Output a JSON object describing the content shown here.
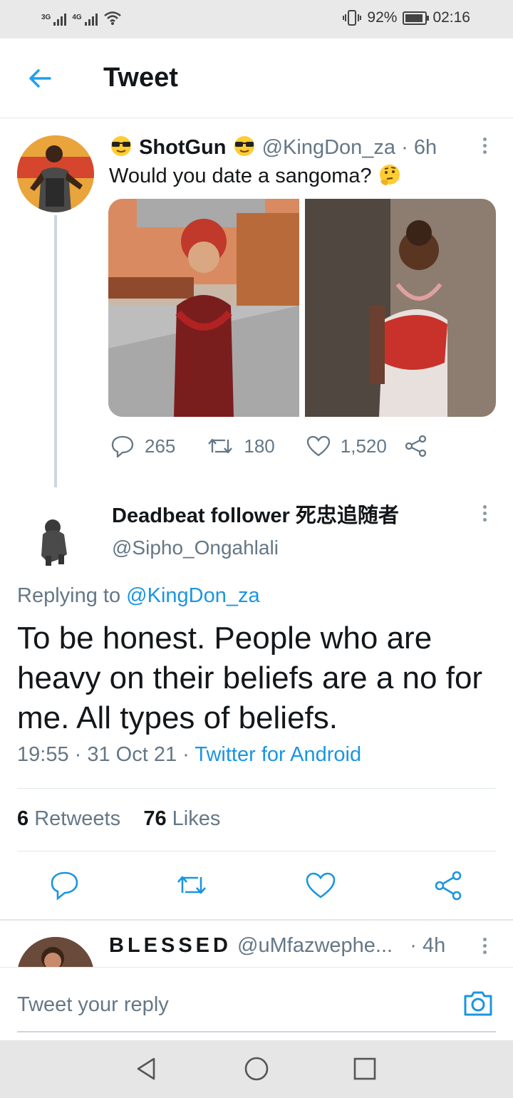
{
  "status_bar": {
    "network_1": "3G",
    "network_2": "4G",
    "battery_percent": "92%",
    "time": "02:16"
  },
  "header": {
    "title": "Tweet"
  },
  "original_tweet": {
    "author_name": "ShotGun",
    "handle": "@KingDon_za",
    "age": "· 6h",
    "text": "Would you date a sangoma?",
    "replies": "265",
    "retweets": "180",
    "likes": "1,520"
  },
  "reply_tweet": {
    "author_name": "Deadbeat follower 死忠追随者",
    "handle": "@Sipho_Ongahlali",
    "replying_to_label": "Replying to",
    "replying_to_handle": "@KingDon_za",
    "text": "To be honest. People who are heavy on their beliefs are a no for me. All types of beliefs.",
    "timestamp": "19:55 · 31 Oct 21 ·",
    "client": "Twitter for Android",
    "retweet_count": "6",
    "retweet_label": "Retweets",
    "like_count": "76",
    "like_label": "Likes"
  },
  "next_reply": {
    "author_name": "BLESSED",
    "handle": "@uMfazwephe...",
    "age": "· 4h"
  },
  "composer": {
    "placeholder": "Tweet your reply"
  },
  "colors": {
    "accent": "#1b95e0",
    "muted": "#657786",
    "divider": "#e1e8ed"
  }
}
